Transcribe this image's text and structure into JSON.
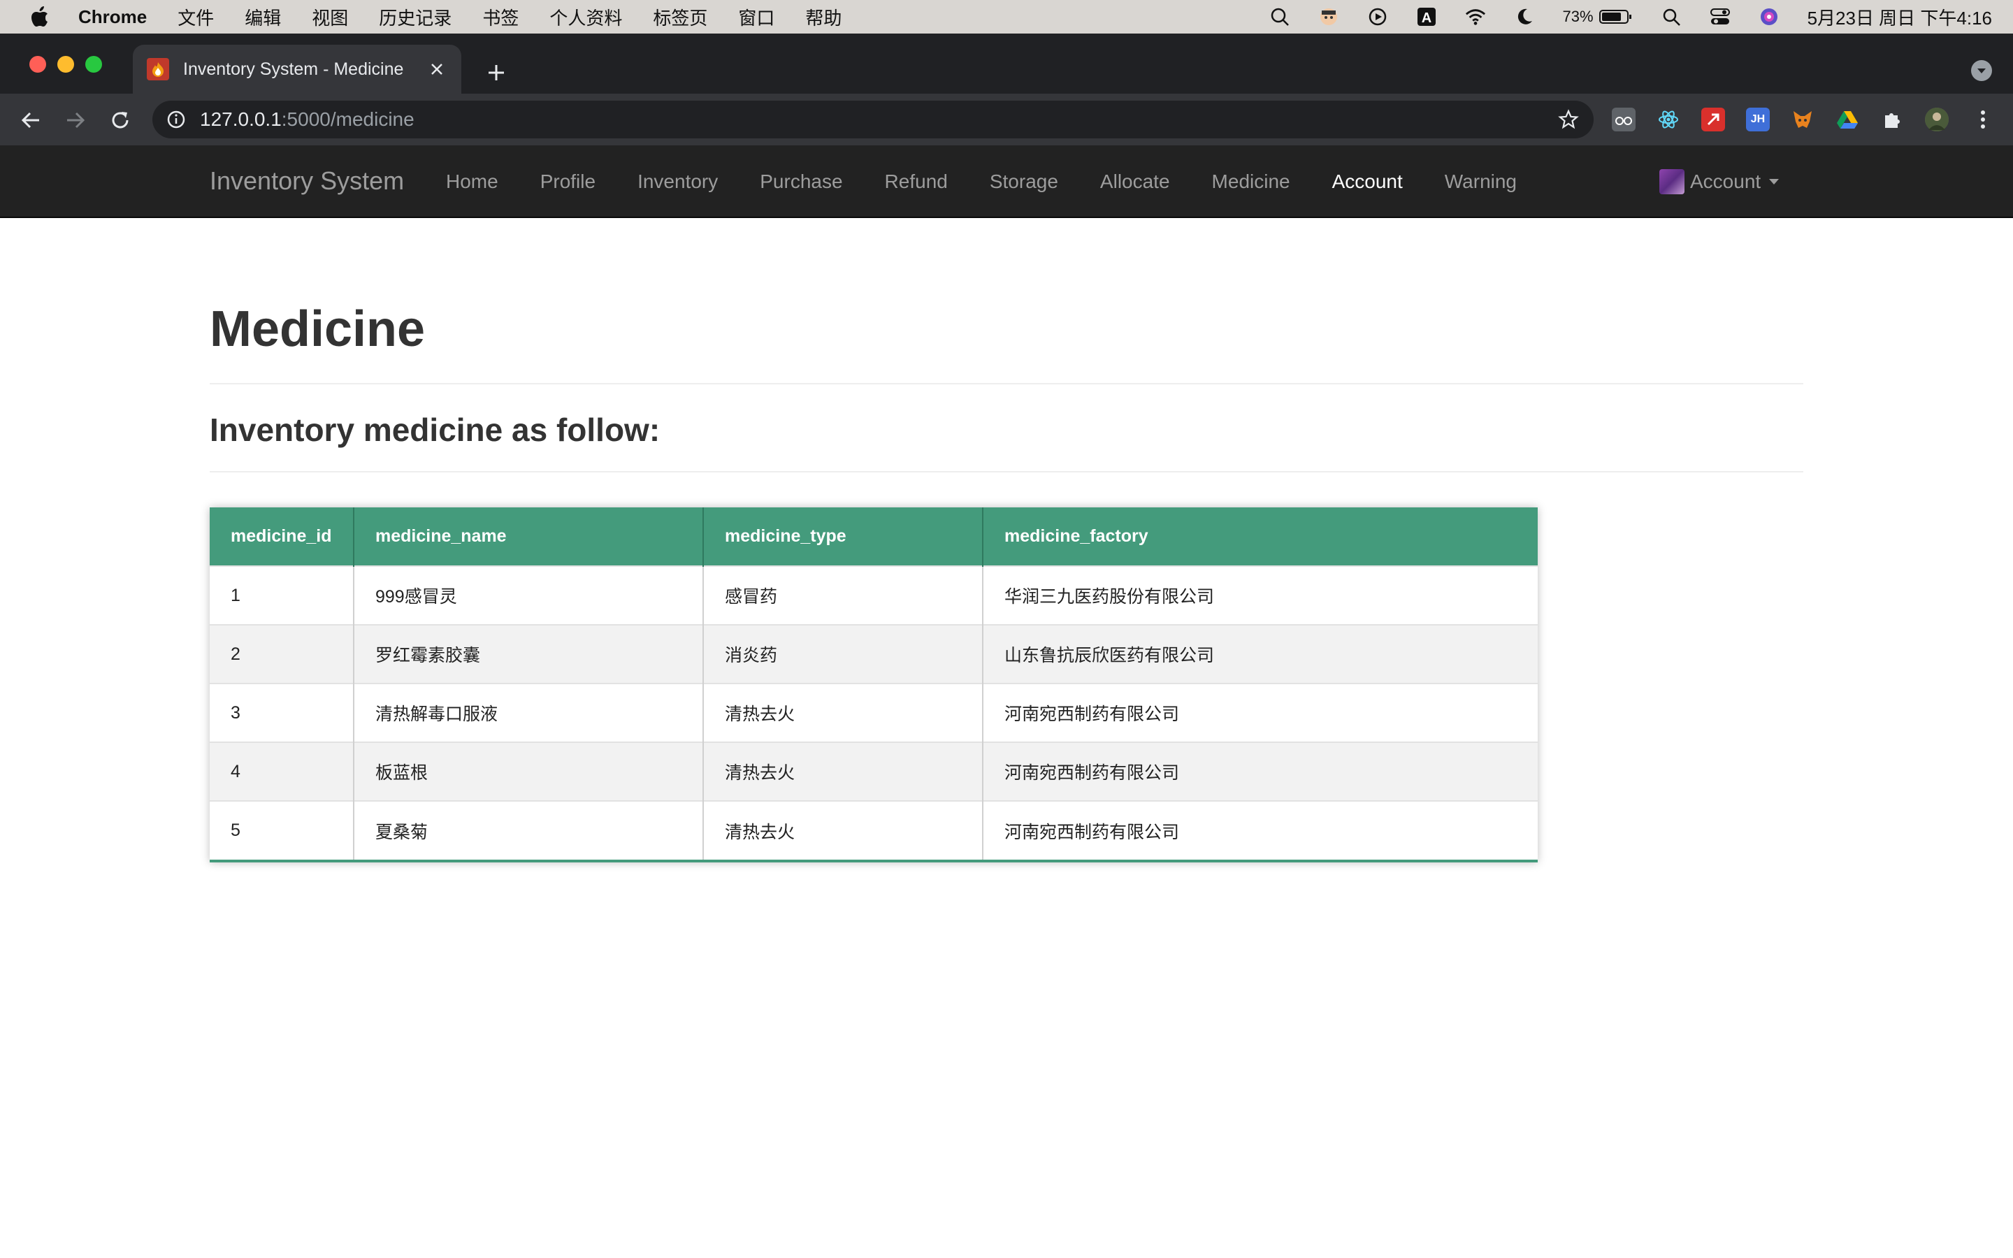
{
  "menubar": {
    "app_name": "Chrome",
    "items": [
      "文件",
      "编辑",
      "视图",
      "历史记录",
      "书签",
      "个人资料",
      "标签页",
      "窗口",
      "帮助"
    ],
    "battery": "73%",
    "clock": "5月23日 周日 下午4:16"
  },
  "browser": {
    "tab_title": "Inventory System - Medicine",
    "url_host": "127.0.0.1",
    "url_rest": ":5000/medicine"
  },
  "navbar": {
    "brand": "Inventory System",
    "links": [
      "Home",
      "Profile",
      "Inventory",
      "Purchase",
      "Refund",
      "Storage",
      "Allocate",
      "Medicine",
      "Account",
      "Warning"
    ],
    "active": "Account",
    "account_label": "Account"
  },
  "page": {
    "title": "Medicine",
    "subtitle": "Inventory medicine as follow:"
  },
  "table": {
    "headers": [
      "medicine_id",
      "medicine_name",
      "medicine_type",
      "medicine_factory"
    ],
    "rows": [
      [
        "1",
        "999感冒灵",
        "感冒药",
        "华润三九医药股份有限公司"
      ],
      [
        "2",
        "罗红霉素胶囊",
        "消炎药",
        "山东鲁抗辰欣医药有限公司"
      ],
      [
        "3",
        "清热解毒口服液",
        "清热去火",
        "河南宛西制药有限公司"
      ],
      [
        "4",
        "板蓝根",
        "清热去火",
        "河南宛西制药有限公司"
      ],
      [
        "5",
        "夏桑菊",
        "清热去火",
        "河南宛西制药有限公司"
      ]
    ]
  },
  "colors": {
    "table_header": "#449b7c",
    "navbar_bg": "#222222"
  }
}
